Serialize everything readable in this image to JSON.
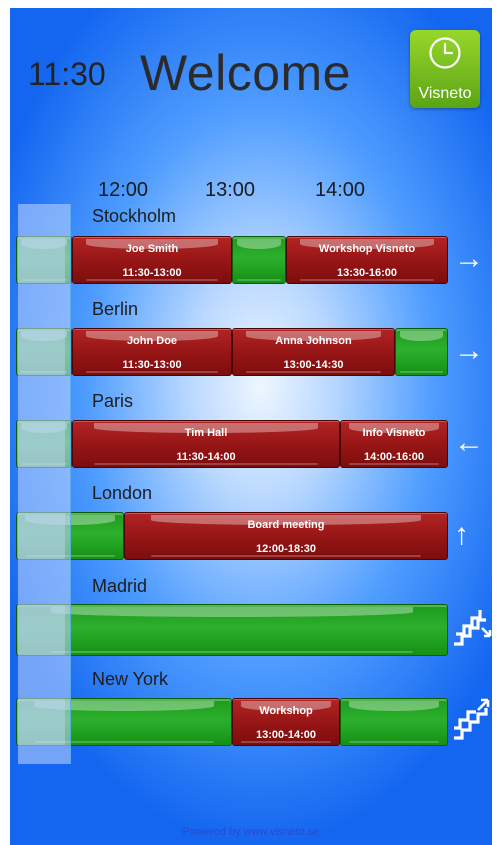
{
  "header": {
    "clock": "11:30",
    "title": "Welcome",
    "logo_label": "Visneto"
  },
  "timeline": {
    "hours": [
      "12:00",
      "13:00",
      "14:00"
    ]
  },
  "rooms": [
    {
      "city": "Stockholm",
      "direction": "→",
      "bookings": [
        {
          "name": "Joe Smith",
          "time": "11:30-13:00"
        },
        {
          "name": "Workshop Visneto",
          "time": "13:30-16:00"
        }
      ]
    },
    {
      "city": "Berlin",
      "direction": "→",
      "bookings": [
        {
          "name": "John Doe",
          "time": "11:30-13:00"
        },
        {
          "name": "Anna Johnson",
          "time": "13:00-14:30"
        }
      ]
    },
    {
      "city": "Paris",
      "direction": "←",
      "bookings": [
        {
          "name": "Tim Hall",
          "time": "11:30-14:00"
        },
        {
          "name": "Info Visneto",
          "time": "14:00-16:00"
        }
      ]
    },
    {
      "city": "London",
      "direction": "↑",
      "bookings": [
        {
          "name": "Board meeting",
          "time": "12:00-18:30"
        }
      ]
    },
    {
      "city": "Madrid",
      "direction": "stairs-down-icon",
      "bookings": []
    },
    {
      "city": "New York",
      "direction": "stairs-up-icon",
      "bookings": [
        {
          "name": "Workshop",
          "time": "13:00-14:00"
        }
      ]
    }
  ],
  "footer": {
    "text": "Powered by www.visneto.se"
  },
  "colors": {
    "free": "#1d9a1d",
    "busy": "#981616",
    "logo": "#7cc21f"
  }
}
